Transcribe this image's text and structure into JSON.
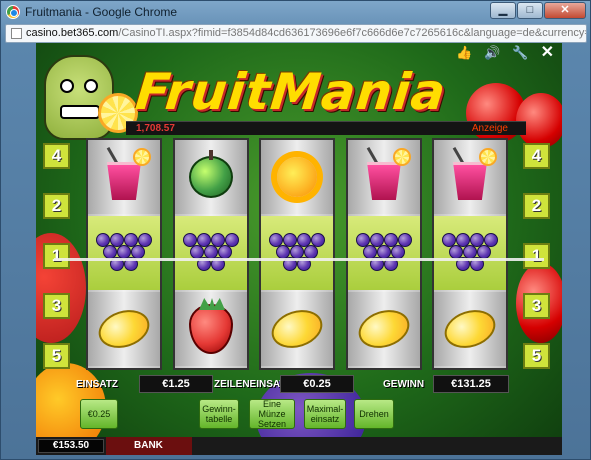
{
  "window": {
    "title": "Fruitmania - Google Chrome",
    "buttons": {
      "minimize": "▁",
      "maximize": "□",
      "close": "✕"
    }
  },
  "address_bar": {
    "host": "casino.bet365.com",
    "path": "/CasinoTI.aspx?fimid=f3854d84cd636173696e6f7c666d6e7c7265616c&language=de&currency=EUR&cashierdomain=casino."
  },
  "game_toolbar": {
    "icons": [
      "thumbs-up-icon",
      "speaker-icon",
      "wrench-icon",
      "close-icon"
    ]
  },
  "game": {
    "logo": "FruitMania",
    "jackpot": "1,708.57",
    "info_link": "Anzeige",
    "paylines_left": [
      "4",
      "2",
      "1",
      "3",
      "5"
    ],
    "paylines_right": [
      "4",
      "2",
      "1",
      "3",
      "5"
    ],
    "reels": [
      [
        "drink",
        "grapes",
        "lemon"
      ],
      [
        "apple",
        "grapes",
        "strawberry"
      ],
      [
        "sun",
        "grapes",
        "lemon"
      ],
      [
        "drink",
        "grapes",
        "lemon"
      ],
      [
        "drink",
        "grapes",
        "lemon"
      ]
    ],
    "stats": {
      "einsatz_label": "EINSATZ",
      "einsatz_value": "€1.25",
      "zeileneinsatz_label": "ZEILENEINSATZ",
      "zeileneinsatz_value": "€0.25",
      "gewinn_label": "GEWINN",
      "gewinn_value": "€131.25"
    },
    "buttons": {
      "coin_value": "€0.25",
      "paytable": "Gewinn-tabelle",
      "bet_one": "Eine Münze Setzen",
      "max_bet": "Maximal-einsatz",
      "spin": "Drehen"
    },
    "balance": {
      "value": "€153.50",
      "bank_label": "BANK"
    }
  }
}
